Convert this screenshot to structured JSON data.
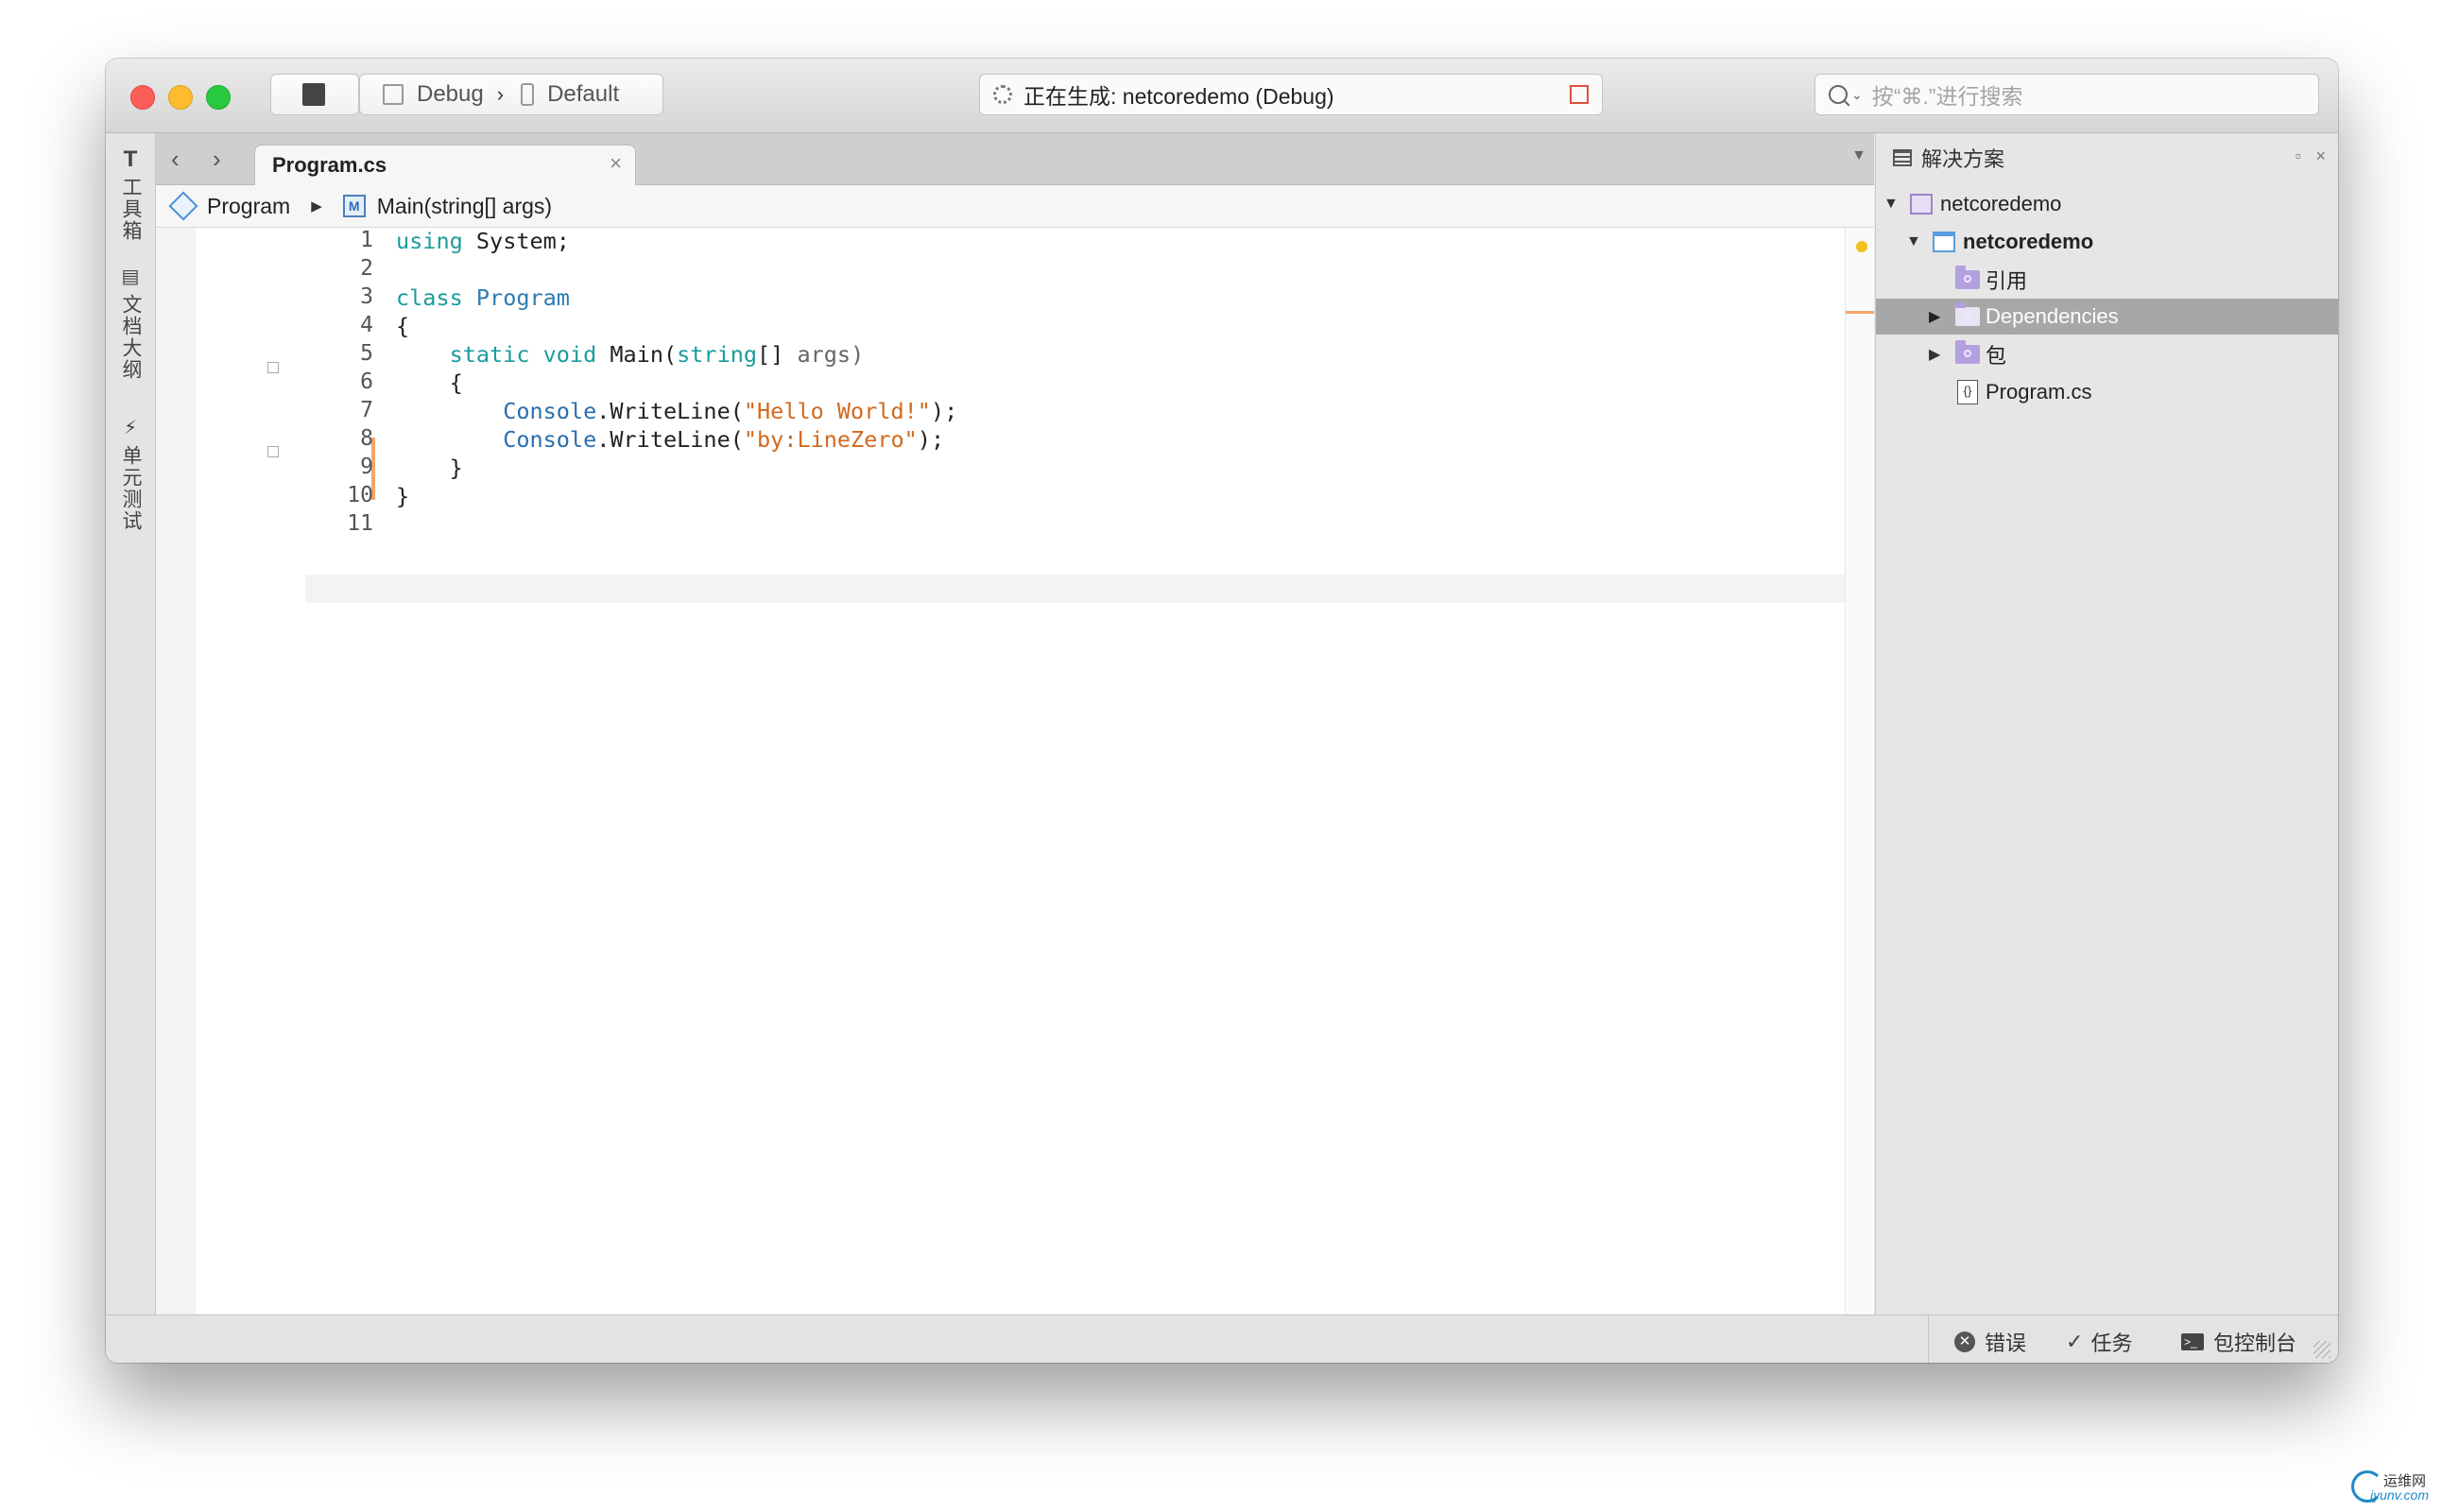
{
  "toolbar": {
    "configuration": "Debug",
    "separator": "›",
    "device": "Default",
    "status_text": "正在生成: netcoredemo (Debug)",
    "search_placeholder": "按“⌘.”进行搜索"
  },
  "left_pads": [
    {
      "label": "工具箱",
      "icon": "T"
    },
    {
      "label": "文档大纲",
      "icon": "▤"
    },
    {
      "label": "单元测试",
      "icon": "⚡"
    }
  ],
  "editor_tab": {
    "title": "Program.cs",
    "close": "×",
    "dropdown": "▼"
  },
  "breadcrumb": {
    "class": "Program",
    "separator": "▶",
    "method_icon": "M",
    "method": "Main(string[] args)"
  },
  "code": {
    "line_numbers": [
      "1",
      "2",
      "3",
      "4",
      "5",
      "6",
      "7",
      "8",
      "9",
      "10",
      "11"
    ],
    "lines": [
      {
        "parts": [
          {
            "t": "using",
            "c": "kw"
          },
          {
            "t": " System;",
            "c": ""
          }
        ]
      },
      {
        "parts": []
      },
      {
        "parts": [
          {
            "t": "class",
            "c": "kw"
          },
          {
            "t": " ",
            "c": ""
          },
          {
            "t": "Program",
            "c": "kw2"
          }
        ]
      },
      {
        "parts": [
          {
            "t": "{",
            "c": ""
          }
        ]
      },
      {
        "parts": [
          {
            "t": "    ",
            "c": ""
          },
          {
            "t": "static",
            "c": "kw"
          },
          {
            "t": " ",
            "c": ""
          },
          {
            "t": "void",
            "c": "kw"
          },
          {
            "t": " Main(",
            "c": ""
          },
          {
            "t": "string",
            "c": "kw"
          },
          {
            "t": "[] ",
            "c": ""
          },
          {
            "t": "args",
            "c": "arg"
          },
          {
            "t": ")",
            "c": "arg"
          }
        ]
      },
      {
        "parts": [
          {
            "t": "    {",
            "c": ""
          }
        ]
      },
      {
        "parts": [
          {
            "t": "        ",
            "c": ""
          },
          {
            "t": "Console",
            "c": "ty"
          },
          {
            "t": ".WriteLine(",
            "c": ""
          },
          {
            "t": "\"Hello World!\"",
            "c": "str"
          },
          {
            "t": ");",
            "c": ""
          }
        ]
      },
      {
        "parts": [
          {
            "t": "        ",
            "c": ""
          },
          {
            "t": "Console",
            "c": "ty"
          },
          {
            "t": ".WriteLine(",
            "c": ""
          },
          {
            "t": "\"by:LineZero\"",
            "c": "str"
          },
          {
            "t": ");",
            "c": ""
          }
        ]
      },
      {
        "parts": [
          {
            "t": "    }",
            "c": ""
          }
        ]
      },
      {
        "parts": [
          {
            "t": "}",
            "c": ""
          }
        ]
      },
      {
        "parts": []
      }
    ]
  },
  "solution": {
    "title": "解决方案",
    "items": [
      {
        "label": "netcoredemo",
        "level": 0,
        "expanded": true,
        "icon": "solution-icon"
      },
      {
        "label": "netcoredemo",
        "level": 1,
        "expanded": true,
        "icon": "project-icon",
        "bold": true
      },
      {
        "label": "引用",
        "level": 2,
        "icon": "folder-icon"
      },
      {
        "label": "Dependencies",
        "level": 2,
        "expandable": true,
        "icon": "folder-icon",
        "selected": true
      },
      {
        "label": "包",
        "level": 2,
        "expandable": true,
        "icon": "folder-icon"
      },
      {
        "label": "Program.cs",
        "level": 2,
        "icon": "file-icon"
      }
    ]
  },
  "statusbar": {
    "errors": "错误",
    "tasks": "任务",
    "console": "包控制台"
  },
  "watermark": {
    "top": "运维网",
    "bottom": "iyunv.com"
  },
  "colors": {
    "keyword": "#1a9c9c",
    "string": "#d2691e",
    "selection": "#a7a7a7",
    "change_marker": "#f2a56c",
    "warning": "#f2c01e"
  }
}
